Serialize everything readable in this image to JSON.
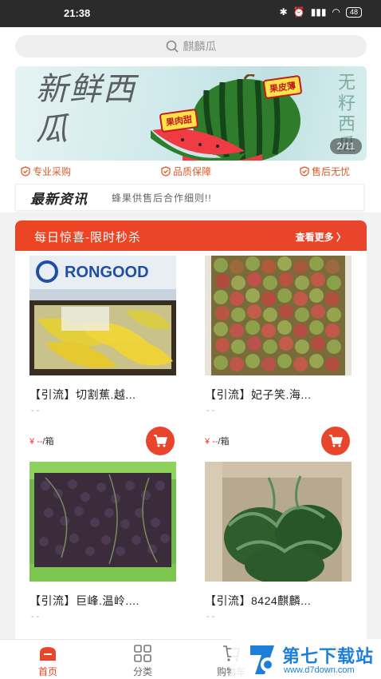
{
  "status": {
    "time": "21:38",
    "battery": "48"
  },
  "search": {
    "placeholder": "麒麟瓜"
  },
  "banner": {
    "title": "新鲜西瓜",
    "side_text": "无籽西瓜",
    "badge_flesh": "果肉甜",
    "badge_skin": "果皮薄",
    "counter": "2/11"
  },
  "guarantees": [
    "专业采购",
    "品质保障",
    "售后无忧"
  ],
  "news": {
    "logo": "最新资讯",
    "text": "蜂果供售后合作细则!!"
  },
  "flash_sale": {
    "title": "每日惊喜-限时秒杀",
    "more": "查看更多"
  },
  "products": [
    {
      "name": "【引流】切割蕉.越...",
      "sub": "--",
      "price_symbol": "¥",
      "price": "--",
      "unit": "/箱",
      "image": "banana-box",
      "brand": "RONGOOD"
    },
    {
      "name": "【引流】妃子笑.海...",
      "sub": "--",
      "price_symbol": "¥",
      "price": "--",
      "unit": "/箱",
      "image": "lychee-box"
    },
    {
      "name": "【引流】巨峰.温岭....",
      "sub": "--",
      "image": "grape-box"
    },
    {
      "name": "【引流】8424麒麟...",
      "sub": "--",
      "image": "watermelon-box"
    }
  ],
  "tabs": [
    {
      "label": "首页",
      "icon": "home-icon",
      "active": true
    },
    {
      "label": "分类",
      "icon": "category-icon",
      "active": false
    },
    {
      "label": "购物车",
      "icon": "cart-icon",
      "active": false
    },
    {
      "label": "我的",
      "icon": "user-icon",
      "active": false
    }
  ],
  "watermark": {
    "title": "第七下载站",
    "url": "www.d7down.com"
  },
  "colors": {
    "accent": "#e8462c",
    "guarantee": "#e05a2a",
    "watermark": "#1d7fd8"
  }
}
